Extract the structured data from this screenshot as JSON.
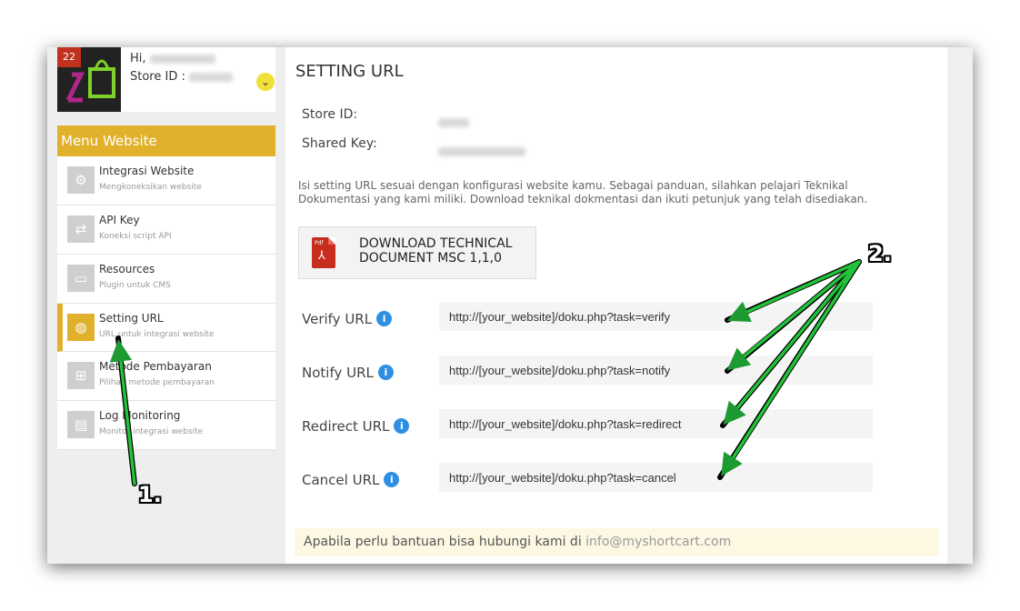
{
  "user": {
    "badge": "22",
    "greeting": "Hi,",
    "store_id_label": "Store ID :"
  },
  "sidebar": {
    "header": "Menu Website",
    "items": [
      {
        "label": "Integrasi Website",
        "sub": "Mengkoneksikan website",
        "icon": "gear-icon"
      },
      {
        "label": "API Key",
        "sub": "Koneksi script API",
        "icon": "arrows-icon"
      },
      {
        "label": "Resources",
        "sub": "Plugin untuk CMS",
        "icon": "inbox-icon"
      },
      {
        "label": "Setting URL",
        "sub": "URL untuk integrasi website",
        "icon": "www-icon",
        "active": true
      },
      {
        "label": "Metode Pembayaran",
        "sub": "Pilihan metode pembayaran",
        "icon": "sitemap-icon"
      },
      {
        "label": "Log Monitoring",
        "sub": "Monitor integrasi website",
        "icon": "window-icon"
      }
    ]
  },
  "main": {
    "title": "SETTING URL",
    "store_id_label": "Store ID:",
    "shared_key_label": "Shared Key:",
    "description": "Isi setting URL sesuai dengan konfigurasi website kamu. Sebagai panduan, silahkan pelajari Teknikal Dokumentasi yang kami miliki. Download teknikal dokmentasi dan ikuti petunjuk yang telah disediakan.",
    "download": {
      "line1": "DOWNLOAD TECHNICAL",
      "line2": "DOCUMENT MSC 1,1,0",
      "pdf_tag": "Pdf",
      "pdf_symbol": "⅄"
    },
    "urls": [
      {
        "label": "Verify URL",
        "value": "http://[your_website]/doku.php?task=verify"
      },
      {
        "label": "Notify URL",
        "value": "http://[your_website]/doku.php?task=notify"
      },
      {
        "label": "Redirect URL",
        "value": "http://[your_website]/doku.php?task=redirect"
      },
      {
        "label": "Cancel URL",
        "value": "http://[your_website]/doku.php?task=cancel"
      }
    ],
    "help_text": "Apabila perlu bantuan bisa hubungi kami di ",
    "help_email": "info@myshortcart.com"
  },
  "annotations": {
    "marker1": "1.",
    "marker2": "2.",
    "arrow_color": "#22b33a"
  },
  "colors": {
    "accent": "#e1b12b",
    "info": "#2f8fe3"
  }
}
